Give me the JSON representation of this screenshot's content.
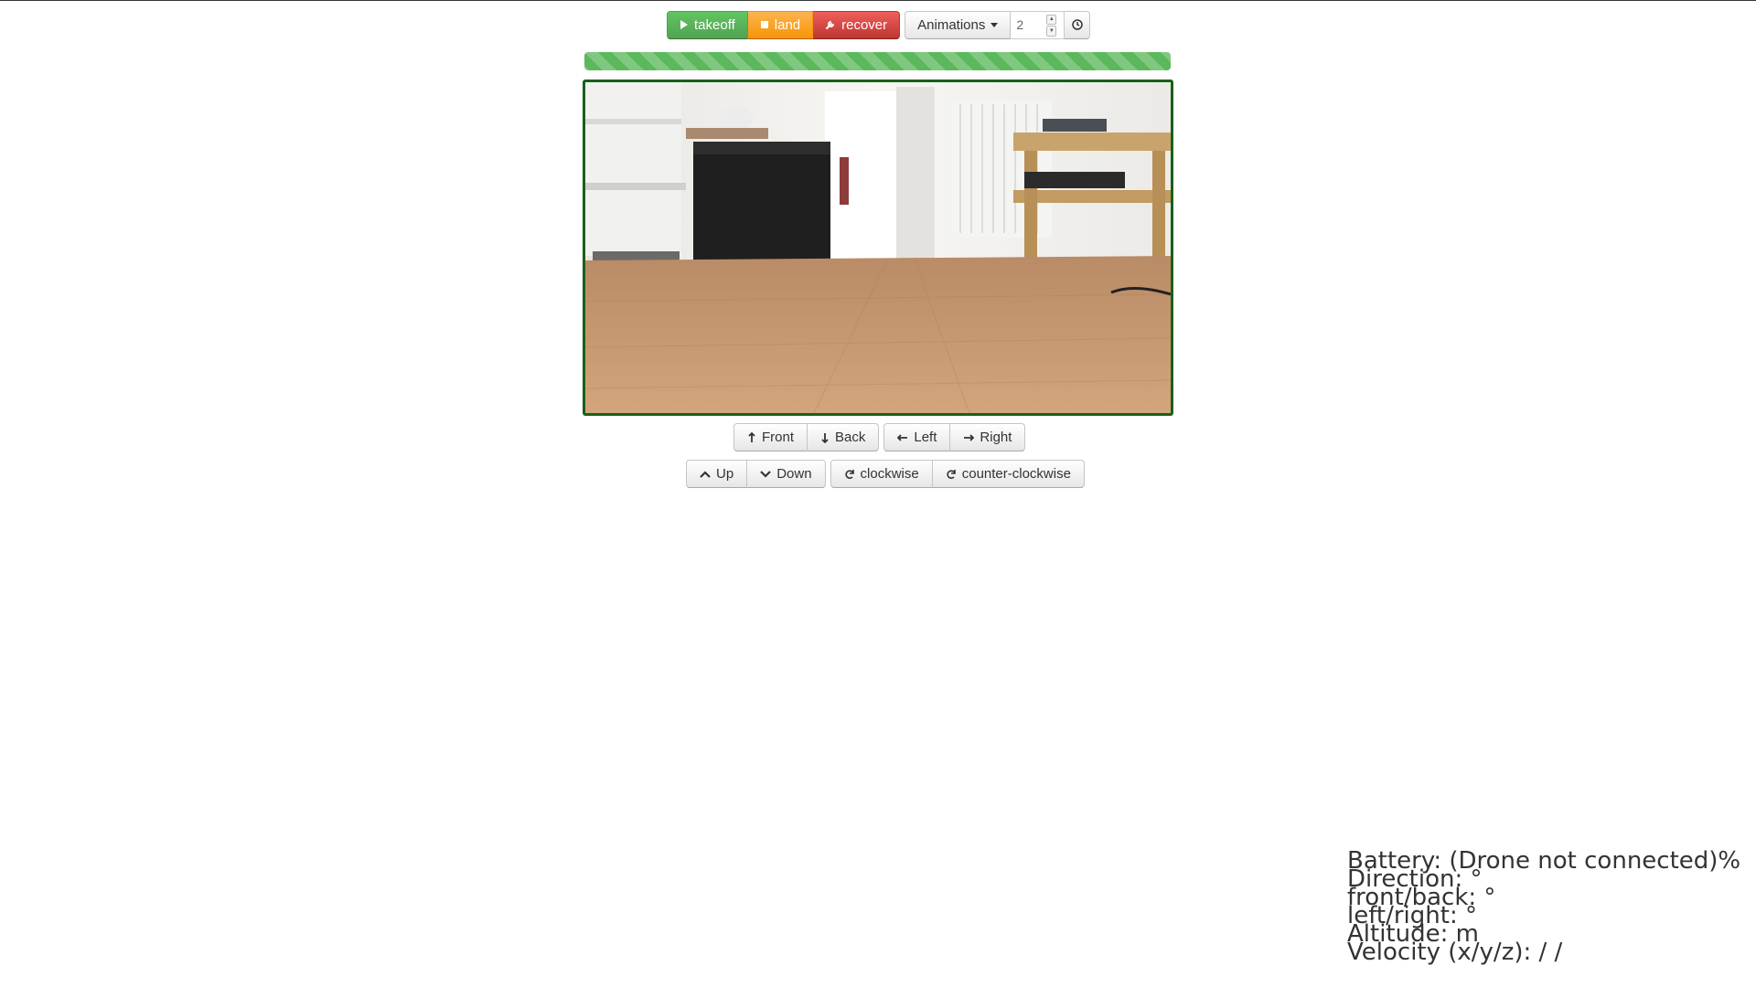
{
  "toolbar": {
    "takeoff_label": "takeoff",
    "land_label": "land",
    "recover_label": "recover",
    "animations_label": "Animations",
    "duration_value": "2",
    "takeoff_icon": "play-icon",
    "land_icon": "stop-icon",
    "recover_icon": "wrench-icon",
    "clock_icon": "clock-icon"
  },
  "progress": {
    "fraction": 1.0,
    "color": "#5cb85c"
  },
  "video": {
    "frame_color": "#1a5f1a",
    "description_icon": "camera-feed"
  },
  "move": {
    "front_label": "Front",
    "back_label": "Back",
    "left_label": "Left",
    "right_label": "Right",
    "up_label": "Up",
    "down_label": "Down",
    "clockwise_label": "clockwise",
    "counter_clockwise_label": "counter-clockwise"
  },
  "status": {
    "battery": "Battery: (Drone not connected)%",
    "direction": "Direction: °",
    "front_back": "front/back: °",
    "left_right": "left/right: °",
    "altitude": "Altitude: m",
    "velocity": "Velocity (x/y/z): / /"
  },
  "colors": {
    "success": "#5cb85c",
    "warning": "#f89406",
    "danger": "#bd362f"
  }
}
